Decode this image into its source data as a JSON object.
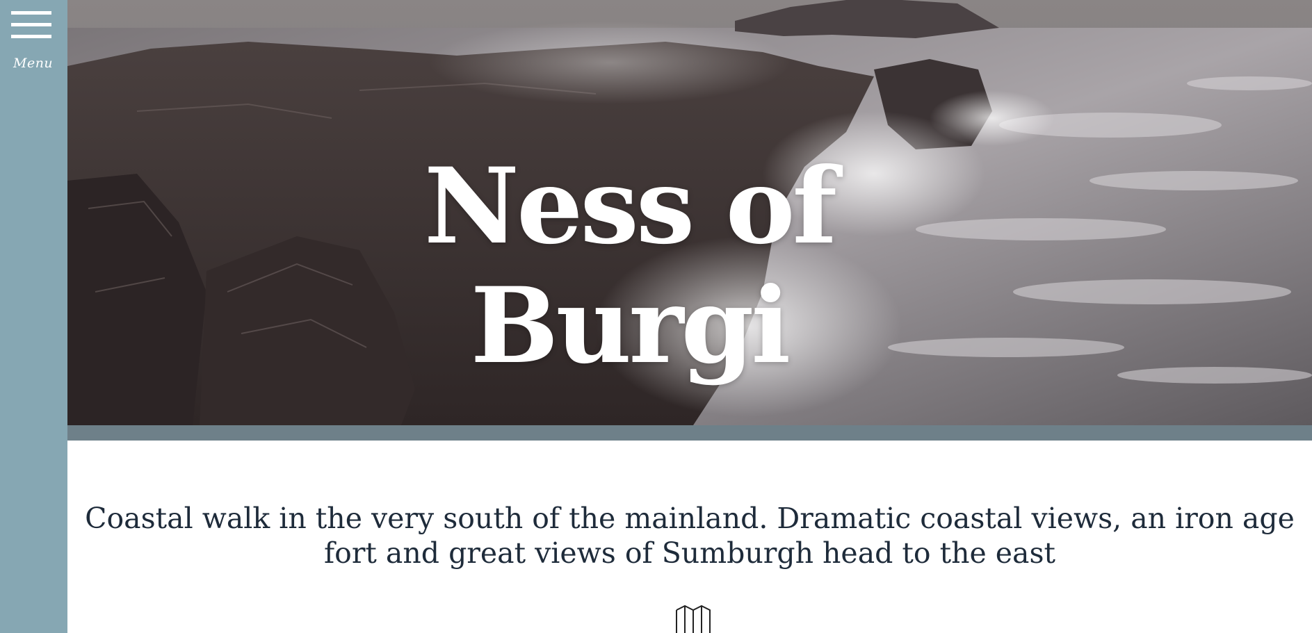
{
  "sidebar": {
    "menu_label": "Menu",
    "menu_icon": "hamburger-icon",
    "background": "#86a7b3"
  },
  "hero": {
    "title_line1": "Ness of",
    "title_line2": "Burgi",
    "image": "stormy-coastal-cliffs-with-crashing-waves"
  },
  "intro": {
    "text": "Coastal walk in the very south of the mainland. Dramatic coastal views, an iron age fort and great views of Sumburgh head to the east"
  },
  "map": {
    "icon": "map-icon"
  },
  "colors": {
    "accent": "#86a7b3",
    "band": "#6e8089",
    "text": "#1e2b3a"
  }
}
